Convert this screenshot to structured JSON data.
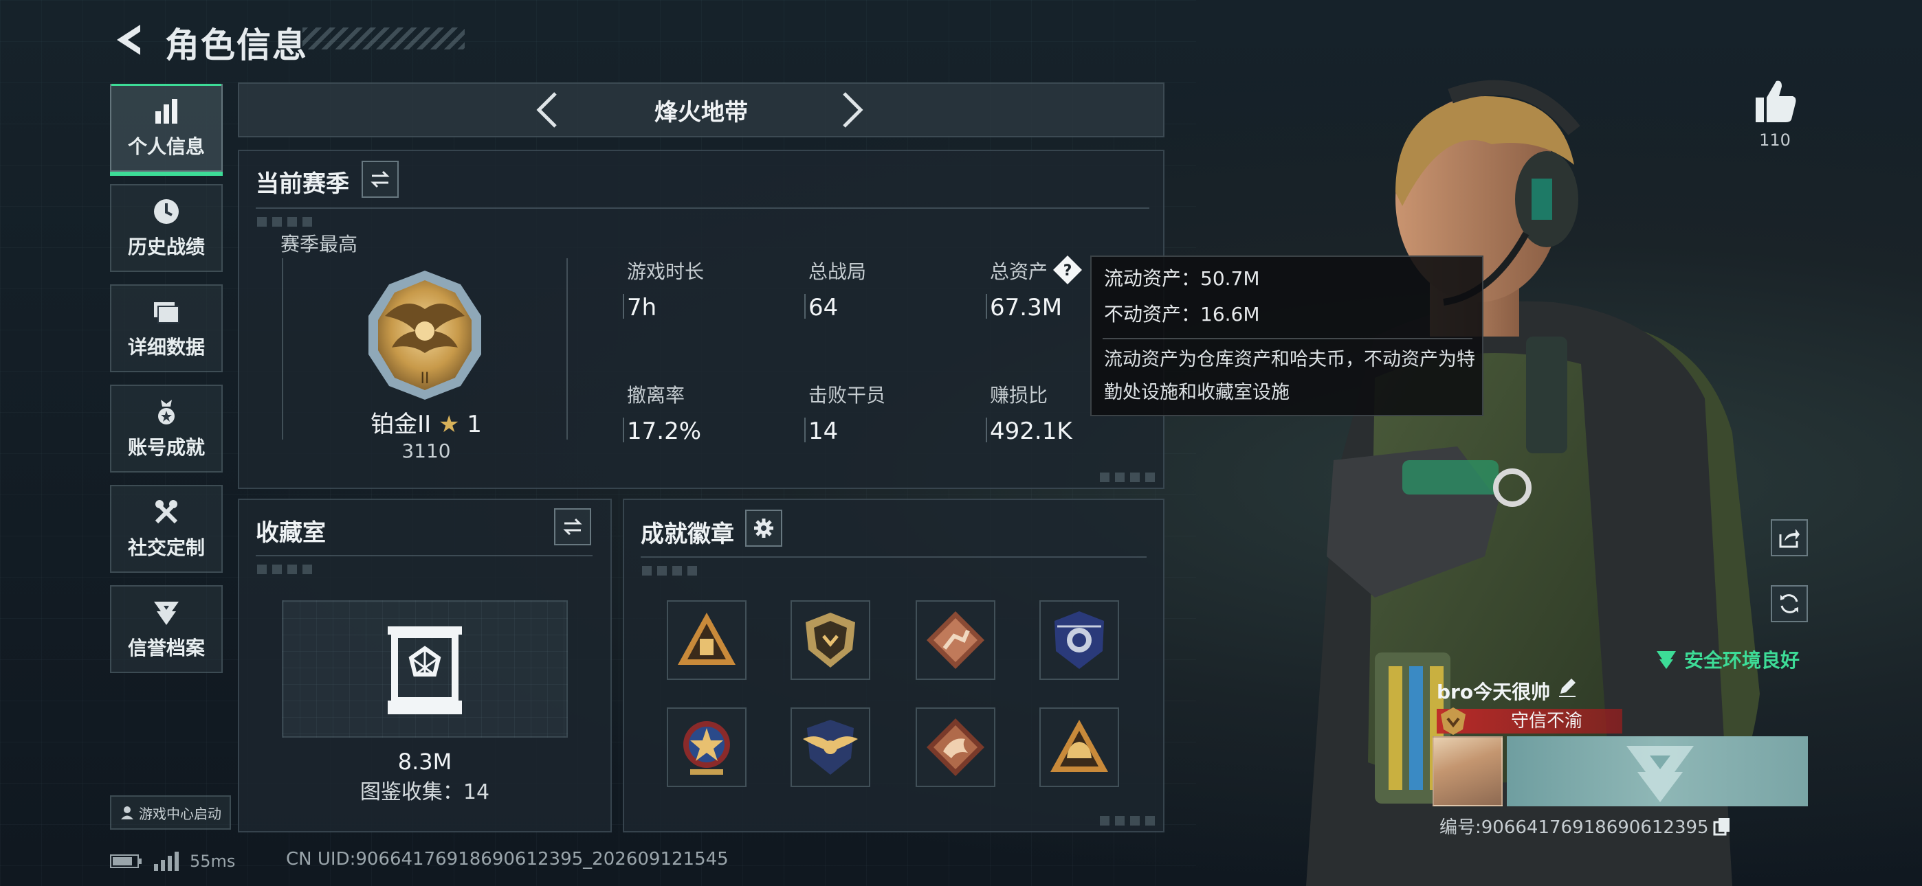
{
  "header": {
    "title": "角色信息",
    "back_icon": "back-arrow-icon"
  },
  "nav": {
    "items": [
      {
        "label": "个人信息",
        "icon": "bar-chart-icon",
        "active": true
      },
      {
        "label": "历史战绩",
        "icon": "clock-icon",
        "active": false
      },
      {
        "label": "详细数据",
        "icon": "folder-icon",
        "active": false
      },
      {
        "label": "账号成就",
        "icon": "medal-icon",
        "active": false
      },
      {
        "label": "社交定制",
        "icon": "tools-icon",
        "active": false
      },
      {
        "label": "信誉档案",
        "icon": "reputation-icon",
        "active": false
      }
    ],
    "game_center_label": "游戏中心启动"
  },
  "mode": {
    "title": "烽火地带"
  },
  "season": {
    "title": "当前赛季",
    "best_label": "赛季最高",
    "rank_name": "铂金II",
    "rank_stars": "1",
    "rank_score": "3110",
    "stats": [
      {
        "label": "游戏时长",
        "value": "7h"
      },
      {
        "label": "总战局",
        "value": "64"
      },
      {
        "label": "总资产",
        "value": "67.3M"
      },
      {
        "label": "撤离率",
        "value": "17.2%"
      },
      {
        "label": "击败干员",
        "value": "14"
      },
      {
        "label": "赚损比",
        "value": "492.1K"
      }
    ]
  },
  "tooltip": {
    "liquid": "流动资产：50.7M",
    "fixed": "不动资产：16.6M",
    "description": "流动资产为仓库资产和哈夫币，不动资产为特勤处设施和收藏室设施"
  },
  "collection": {
    "title": "收藏室",
    "value": "8.3M",
    "count_text": "图鉴收集：14"
  },
  "achievements": {
    "title": "成就徽章",
    "badges": [
      "triangle-badge",
      "shield-badge",
      "diamond-runner-badge",
      "police-badge",
      "star-medal-badge",
      "winged-shield-badge",
      "dragon-badge",
      "helmet-badge"
    ]
  },
  "status": {
    "ping": "55ms",
    "uid": "CN UID:9066417691869061239​5_202609121545"
  },
  "social": {
    "like_count": "110",
    "safe_env": "安全环境良好"
  },
  "player": {
    "name": "bro今天很帅",
    "title": "守信不渝",
    "id_text": "编号:9066417691869061239​5"
  },
  "colors": {
    "accent": "#3ddc97",
    "title_red": "#be2828",
    "gold": "#c89a4a"
  }
}
